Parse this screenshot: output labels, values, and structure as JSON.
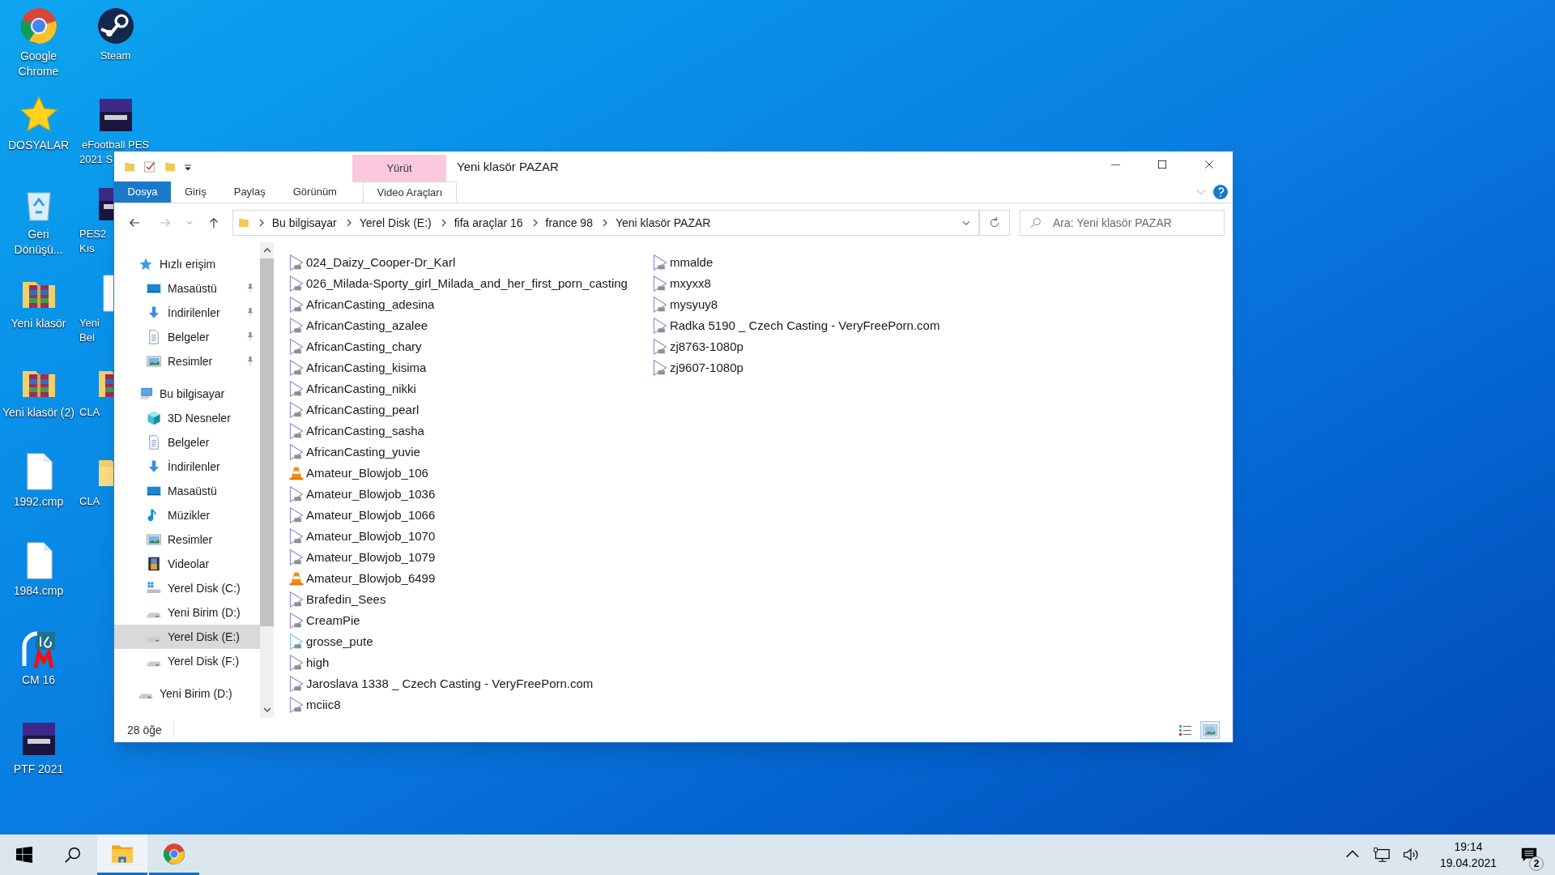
{
  "desktop": {
    "columns": [
      [
        {
          "label": "Google Chrome",
          "kind": "chrome"
        },
        {
          "label": "DOSYALAR",
          "kind": "star"
        },
        {
          "label": "Geri Dönüşü...",
          "kind": "recycle"
        },
        {
          "label": "Yeni klasör",
          "kind": "archive"
        },
        {
          "label": "Yeni klasör (2)",
          "kind": "archive"
        },
        {
          "label": "1992.cmp",
          "kind": "file"
        },
        {
          "label": "1984.cmp",
          "kind": "file"
        },
        {
          "label": "CM 16",
          "kind": "cm"
        },
        {
          "label": "PTF 2021",
          "kind": "game"
        }
      ],
      [
        {
          "label_lines": [
            "Steam"
          ],
          "kind": "steam"
        },
        {
          "label_lines": [
            "eFootball PES",
            "2021 S"
          ],
          "kind": "game"
        },
        {
          "label_lines": [
            "PES2",
            "Kıs"
          ],
          "kind": "game"
        },
        {
          "label_lines": [
            "Yeni",
            "Bel"
          ],
          "kind": "file"
        },
        {
          "label_lines": [
            "CLA"
          ],
          "kind": "archive"
        },
        {
          "label_lines": [
            "CLA"
          ],
          "kind": "folder"
        }
      ]
    ]
  },
  "window": {
    "title": "Yeni klasör PAZAR",
    "context_tab": "Yürüt",
    "ribbon_tabs": [
      {
        "label": "Dosya",
        "kind": "file",
        "selected": false
      },
      {
        "label": "Giriş",
        "kind": "normal",
        "selected": false
      },
      {
        "label": "Paylaş",
        "kind": "normal",
        "selected": false
      },
      {
        "label": "Görünüm",
        "kind": "normal",
        "selected": false
      },
      {
        "label": "Video Araçları",
        "kind": "contextual",
        "selected": false
      }
    ],
    "breadcrumb": [
      "Bu bilgisayar",
      "Yerel Disk (E:)",
      "fifa araçlar 16",
      "france 98",
      "Yeni klasör PAZAR"
    ],
    "search": {
      "placeholder": "Ara: Yeni klasör PAZAR"
    },
    "sidebar": [
      {
        "label": "Hızlı erişim",
        "kind": "quick",
        "selected": false,
        "children": [
          {
            "label": "Masaüstü",
            "kind": "desktop",
            "pinned": true,
            "selected": false
          },
          {
            "label": "İndirilenler",
            "kind": "download",
            "pinned": true,
            "selected": false
          },
          {
            "label": "Belgeler",
            "kind": "docs",
            "pinned": true,
            "selected": false
          },
          {
            "label": "Resimler",
            "kind": "pictures",
            "pinned": true,
            "selected": false
          }
        ]
      },
      {
        "label": "Bu bilgisayar",
        "kind": "pc",
        "selected": false,
        "children": [
          {
            "label": "3D Nesneler",
            "kind": "cube",
            "pinned": false,
            "selected": false
          },
          {
            "label": "Belgeler",
            "kind": "docs",
            "pinned": false,
            "selected": false
          },
          {
            "label": "İndirilenler",
            "kind": "download",
            "pinned": false,
            "selected": false
          },
          {
            "label": "Masaüstü",
            "kind": "desktop",
            "pinned": false,
            "selected": false
          },
          {
            "label": "Müzikler",
            "kind": "music",
            "pinned": false,
            "selected": false
          },
          {
            "label": "Resimler",
            "kind": "pictures",
            "pinned": false,
            "selected": false
          },
          {
            "label": "Videolar",
            "kind": "videos",
            "pinned": false,
            "selected": false
          },
          {
            "label": "Yerel Disk (C:)",
            "kind": "sysdrive",
            "pinned": false,
            "selected": false
          },
          {
            "label": "Yeni Birim (D:)",
            "kind": "drive",
            "pinned": false,
            "selected": false
          },
          {
            "label": "Yerel Disk (E:)",
            "kind": "drive",
            "pinned": false,
            "selected": true
          },
          {
            "label": "Yerel Disk (F:)",
            "kind": "drive",
            "pinned": false,
            "selected": false
          }
        ]
      },
      {
        "label": "Yeni Birim (D:)",
        "kind": "drive",
        "selected": false
      }
    ],
    "files": [
      {
        "name": "024_Daizy_Cooper-Dr_Karl",
        "kind": "video"
      },
      {
        "name": "026_Milada-Sporty_girl_Milada_and_her_first_porn_casting",
        "kind": "video"
      },
      {
        "name": "AfricanCasting_adesina",
        "kind": "video"
      },
      {
        "name": "AfricanCasting_azalee",
        "kind": "video"
      },
      {
        "name": "AfricanCasting_chary",
        "kind": "video"
      },
      {
        "name": "AfricanCasting_kisima",
        "kind": "video"
      },
      {
        "name": "AfricanCasting_nikki",
        "kind": "video"
      },
      {
        "name": "AfricanCasting_pearl",
        "kind": "video"
      },
      {
        "name": "AfricanCasting_sasha",
        "kind": "video"
      },
      {
        "name": "AfricanCasting_yuvie",
        "kind": "video"
      },
      {
        "name": "Amateur_Blowjob_106",
        "kind": "vlc"
      },
      {
        "name": "Amateur_Blowjob_1036",
        "kind": "video"
      },
      {
        "name": "Amateur_Blowjob_1066",
        "kind": "video"
      },
      {
        "name": "Amateur_Blowjob_1070",
        "kind": "video"
      },
      {
        "name": "Amateur_Blowjob_1079",
        "kind": "video"
      },
      {
        "name": "Amateur_Blowjob_6499",
        "kind": "vlc"
      },
      {
        "name": "Brafedin_Sees",
        "kind": "video"
      },
      {
        "name": "CreamPie",
        "kind": "video"
      },
      {
        "name": "grosse_pute",
        "kind": "video_alt"
      },
      {
        "name": "high",
        "kind": "video"
      },
      {
        "name": "Jaroslava 1338 _ Czech Casting - VeryFreePorn.com",
        "kind": "video"
      },
      {
        "name": "mciic8",
        "kind": "video"
      },
      {
        "name": "mmalde",
        "kind": "video"
      },
      {
        "name": "mxyxx8",
        "kind": "video"
      },
      {
        "name": "mysyuy8",
        "kind": "video"
      },
      {
        "name": "Radka 5190 _ Czech Casting - VeryFreePorn.com",
        "kind": "video"
      },
      {
        "name": "zj8763-1080p",
        "kind": "video"
      },
      {
        "name": "zj9607-1080p",
        "kind": "video"
      }
    ],
    "status_bar": {
      "count": "28 öğe",
      "views": [
        {
          "kind": "details",
          "selected": false
        },
        {
          "kind": "large",
          "selected": true
        }
      ]
    }
  },
  "taskbar": {
    "apps": [
      {
        "kind": "explorer",
        "active": true,
        "running": true
      },
      {
        "kind": "chrome",
        "active": false,
        "running": true
      }
    ],
    "time": "19:14",
    "date": "19.04.2021",
    "notifications": "2"
  }
}
